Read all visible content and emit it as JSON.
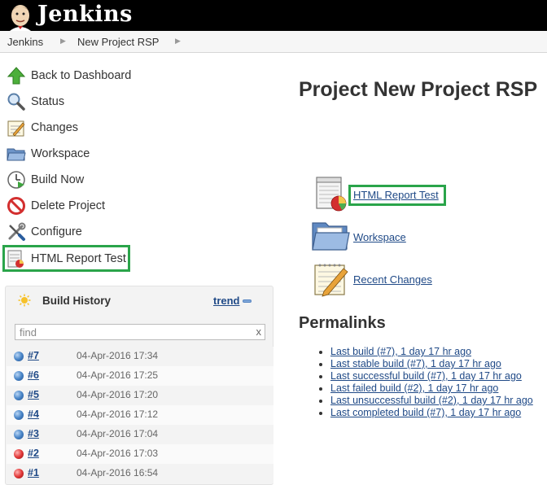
{
  "header": {
    "logo_text": "Jenkins"
  },
  "breadcrumb": [
    {
      "label": "Jenkins"
    },
    {
      "label": "New Project RSP"
    }
  ],
  "tasks": [
    {
      "label": "Back to Dashboard",
      "icon": "up-arrow-icon"
    },
    {
      "label": "Status",
      "icon": "magnifier-icon"
    },
    {
      "label": "Changes",
      "icon": "notepad-icon"
    },
    {
      "label": "Workspace",
      "icon": "folder-icon"
    },
    {
      "label": "Build Now",
      "icon": "clock-play-icon"
    },
    {
      "label": "Delete Project",
      "icon": "no-entry-icon"
    },
    {
      "label": "Configure",
      "icon": "wrench-screwdriver-icon"
    },
    {
      "label": "HTML Report Test",
      "icon": "report-icon"
    }
  ],
  "build_history": {
    "title": "Build History",
    "trend": "trend",
    "search_placeholder": "find",
    "search_clear": "x",
    "builds": [
      {
        "number": "#7",
        "date": "04-Apr-2016 17:34",
        "status": "blue"
      },
      {
        "number": "#6",
        "date": "04-Apr-2016 17:25",
        "status": "blue"
      },
      {
        "number": "#5",
        "date": "04-Apr-2016 17:20",
        "status": "blue"
      },
      {
        "number": "#4",
        "date": "04-Apr-2016 17:12",
        "status": "blue"
      },
      {
        "number": "#3",
        "date": "04-Apr-2016 17:04",
        "status": "blue"
      },
      {
        "number": "#2",
        "date": "04-Apr-2016 17:03",
        "status": "red"
      },
      {
        "number": "#1",
        "date": "04-Apr-2016 16:54",
        "status": "red"
      }
    ]
  },
  "main": {
    "title": "Project New Project RSP",
    "links": [
      {
        "label": "HTML Report Test",
        "icon": "report-icon"
      },
      {
        "label": "Workspace",
        "icon": "folder-icon"
      },
      {
        "label": "Recent Changes",
        "icon": "notepad-icon"
      }
    ],
    "permalinks_title": "Permalinks",
    "permalinks": [
      "Last build (#7), 1 day 17 hr ago",
      "Last stable build (#7), 1 day 17 hr ago",
      "Last successful build (#7), 1 day 17 hr ago",
      "Last failed build (#2), 1 day 17 hr ago",
      "Last unsuccessful build (#2), 1 day 17 hr ago",
      "Last completed build (#7), 1 day 17 hr ago"
    ]
  },
  "colors": {
    "header_bg": "#000000",
    "link": "#204a87",
    "highlight": "#2aa44a",
    "status_success": "#4a86c8",
    "status_failed": "#e23a3a"
  }
}
